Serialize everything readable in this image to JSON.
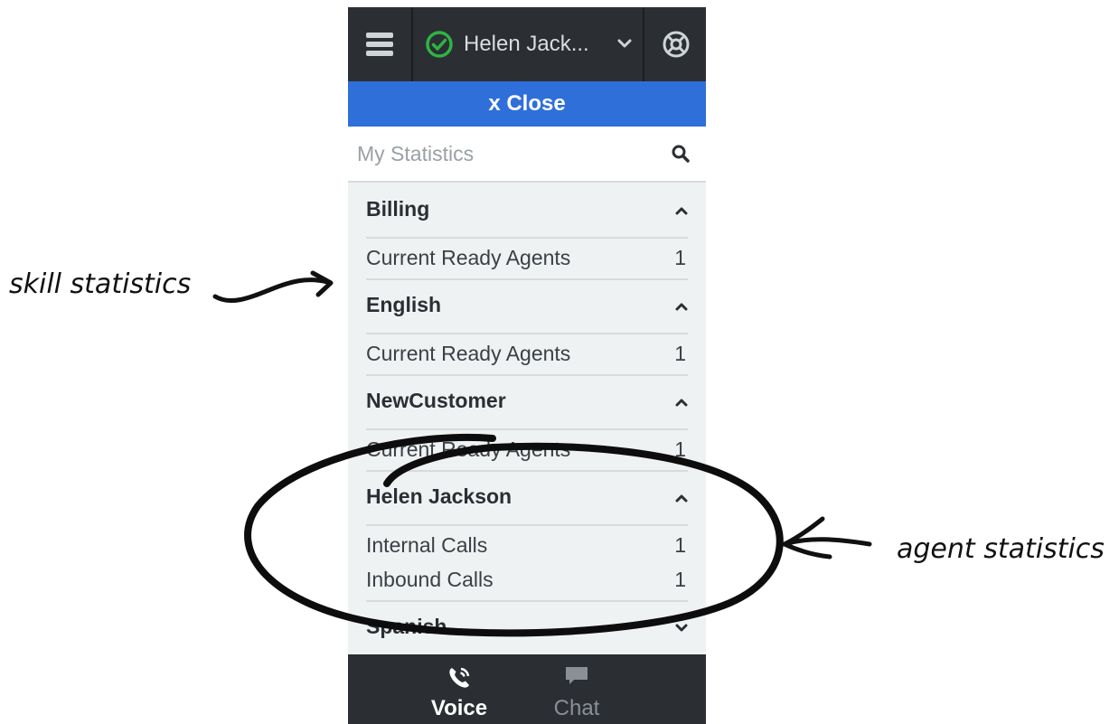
{
  "header": {
    "agent_name": "Helen Jack...",
    "status_color": "#2fb344",
    "icons": {
      "menu": "hamburger-menu-icon",
      "status": "ready-status-icon",
      "dropdown": "chevron-down-icon",
      "help": "lifebuoy-icon"
    }
  },
  "close_bar": {
    "label": "x Close",
    "color": "#2f6fd9"
  },
  "search": {
    "placeholder": "My Statistics",
    "icon": "search-icon"
  },
  "sections": [
    {
      "title": "Billing",
      "expanded": true,
      "rows": [
        {
          "label": "Current Ready Agents",
          "value": "1"
        }
      ]
    },
    {
      "title": "English",
      "expanded": true,
      "rows": [
        {
          "label": "Current Ready Agents",
          "value": "1"
        }
      ]
    },
    {
      "title": "NewCustomer",
      "expanded": true,
      "rows": [
        {
          "label": "Current Ready Agents",
          "value": "1"
        }
      ]
    },
    {
      "title": "Helen Jackson",
      "expanded": true,
      "rows": [
        {
          "label": "Internal Calls",
          "value": "1"
        },
        {
          "label": "Inbound Calls",
          "value": "1"
        }
      ]
    },
    {
      "title": "Spanish",
      "expanded": false,
      "rows": []
    }
  ],
  "bottom_tabs": [
    {
      "label": "Voice",
      "icon": "phone-icon",
      "active": true
    },
    {
      "label": "Chat",
      "icon": "chat-bubble-icon",
      "active": false
    }
  ],
  "annotations": {
    "skill": "skill statistics",
    "agent": "agent statistics"
  }
}
